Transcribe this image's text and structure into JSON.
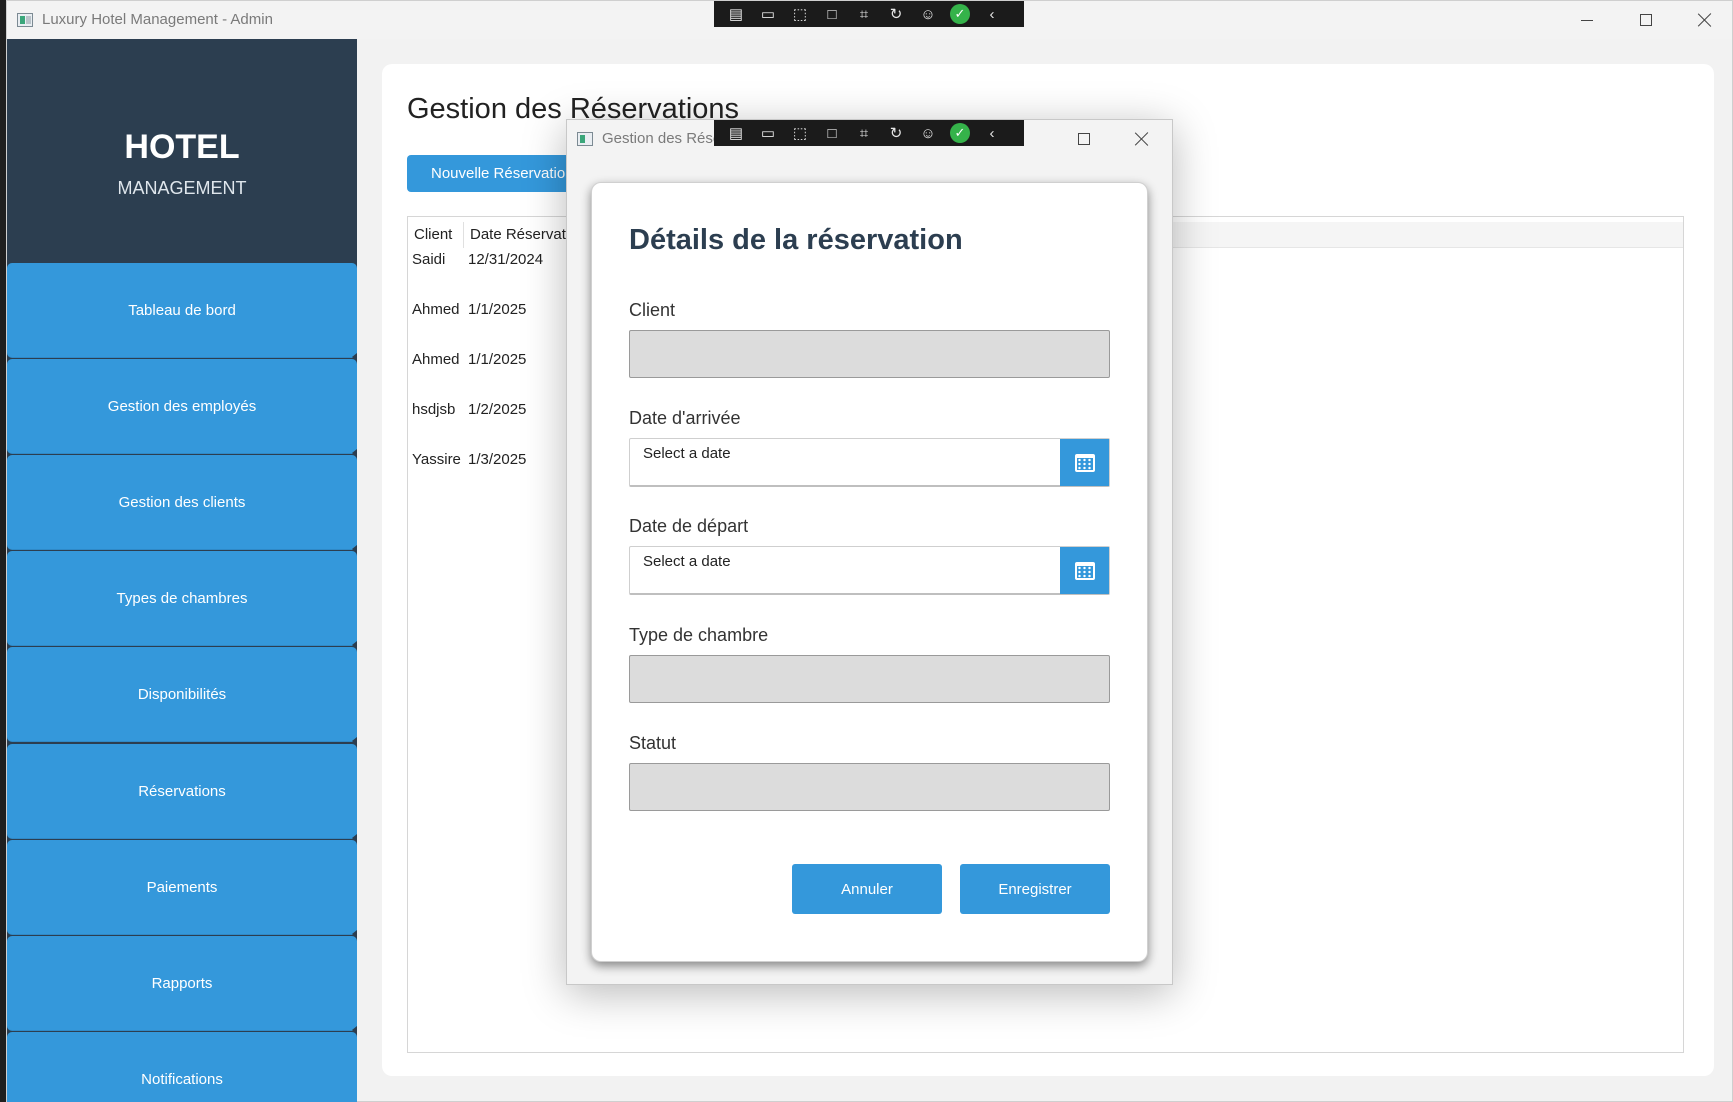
{
  "window": {
    "title": "Luxury Hotel Management - Admin"
  },
  "sidebar": {
    "brand_title": "HOTEL",
    "brand_subtitle": "MANAGEMENT",
    "items": [
      {
        "label": "Tableau de bord"
      },
      {
        "label": "Gestion des employés"
      },
      {
        "label": "Gestion des clients"
      },
      {
        "label": "Types de chambres"
      },
      {
        "label": "Disponibilités"
      },
      {
        "label": "Réservations"
      },
      {
        "label": "Paiements"
      },
      {
        "label": "Rapports"
      },
      {
        "label": "Notifications"
      }
    ]
  },
  "main": {
    "title": "Gestion des Réservations",
    "new_button": "Nouvelle Réservation",
    "grid": {
      "columns": [
        "Client",
        "Date Réservation"
      ],
      "rows": [
        {
          "client": "Saidi",
          "date": "12/31/2024"
        },
        {
          "client": "Ahmed",
          "date": "1/1/2025"
        },
        {
          "client": "Ahmed",
          "date": "1/1/2025"
        },
        {
          "client": "hsdjsb",
          "date": "1/2/2025"
        },
        {
          "client": "Yassire",
          "date": "1/3/2025"
        }
      ]
    }
  },
  "dialog": {
    "window_title": "Gestion des Réservations",
    "heading": "Détails de la réservation",
    "fields": {
      "client_label": "Client",
      "arrival_label": "Date d'arrivée",
      "arrival_placeholder": "Select a date",
      "departure_label": "Date de départ",
      "departure_placeholder": "Select a date",
      "room_type_label": "Type de chambre",
      "status_label": "Statut"
    },
    "cancel_button": "Annuler",
    "save_button": "Enregistrer"
  },
  "colors": {
    "sidebar_bg": "#2c3e50",
    "accent": "#3498db",
    "toolbar_bg": "#1b1b1b",
    "check_green": "#35b34a"
  },
  "debug_toolbar": {
    "icons": [
      "live-tree-icon",
      "video-icon",
      "select-element-icon",
      "display-layout-icon",
      "track-focus-icon",
      "hot-reload-icon",
      "accessibility-icon",
      "check-icon",
      "collapse-icon"
    ]
  }
}
